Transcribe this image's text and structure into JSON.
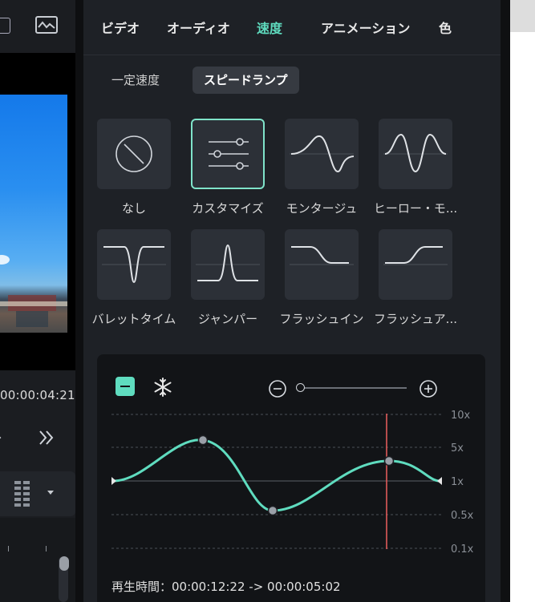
{
  "window": {
    "tabs": [
      {
        "label": "ビデオ",
        "active": false
      },
      {
        "label": "オーディオ",
        "active": false
      },
      {
        "label": "速度",
        "active": true
      },
      {
        "label": "アニメーション",
        "active": false
      },
      {
        "label": "色",
        "active": false
      }
    ],
    "subtabs": [
      {
        "label": "一定速度",
        "active": false
      },
      {
        "label": "スピードランプ",
        "active": true
      }
    ]
  },
  "preview": {
    "timecode": "00:00:04:21",
    "icons": [
      "monitor-icon",
      "image-icon",
      "fast-forward-icon",
      "timeline-grid-icon",
      "dropdown-caret-icon"
    ]
  },
  "presets": [
    {
      "label": "なし",
      "icon": "none-icon",
      "selected": false
    },
    {
      "label": "カスタマイズ",
      "icon": "sliders-icon",
      "selected": true
    },
    {
      "label": "モンタージュ",
      "icon": "montage-curve-icon",
      "selected": false
    },
    {
      "label": "ヒーロー・モ...",
      "icon": "hero-curve-icon",
      "selected": false
    },
    {
      "label": "バレットタイム",
      "icon": "bullet-time-curve-icon",
      "selected": false
    },
    {
      "label": "ジャンパー",
      "icon": "jumper-curve-icon",
      "selected": false
    },
    {
      "label": "フラッシュイン",
      "icon": "flash-in-curve-icon",
      "selected": false
    },
    {
      "label": "フラッシュア...",
      "icon": "flash-out-curve-icon",
      "selected": false
    }
  ],
  "curve_editor": {
    "y_labels": [
      "10x",
      "5x",
      "1x",
      "0.5x",
      "0.1x"
    ],
    "playback_label": "再生時間：00:00:12:22 -> 00:00:05:02",
    "zoom_level": 0.0,
    "colors": {
      "curve": "#5fdcbf",
      "playhead": "#e05a5a",
      "accent": "#5fdcbf"
    },
    "icons": [
      "remove-point-icon",
      "freeze-icon",
      "zoom-out-icon",
      "zoom-in-icon"
    ]
  }
}
